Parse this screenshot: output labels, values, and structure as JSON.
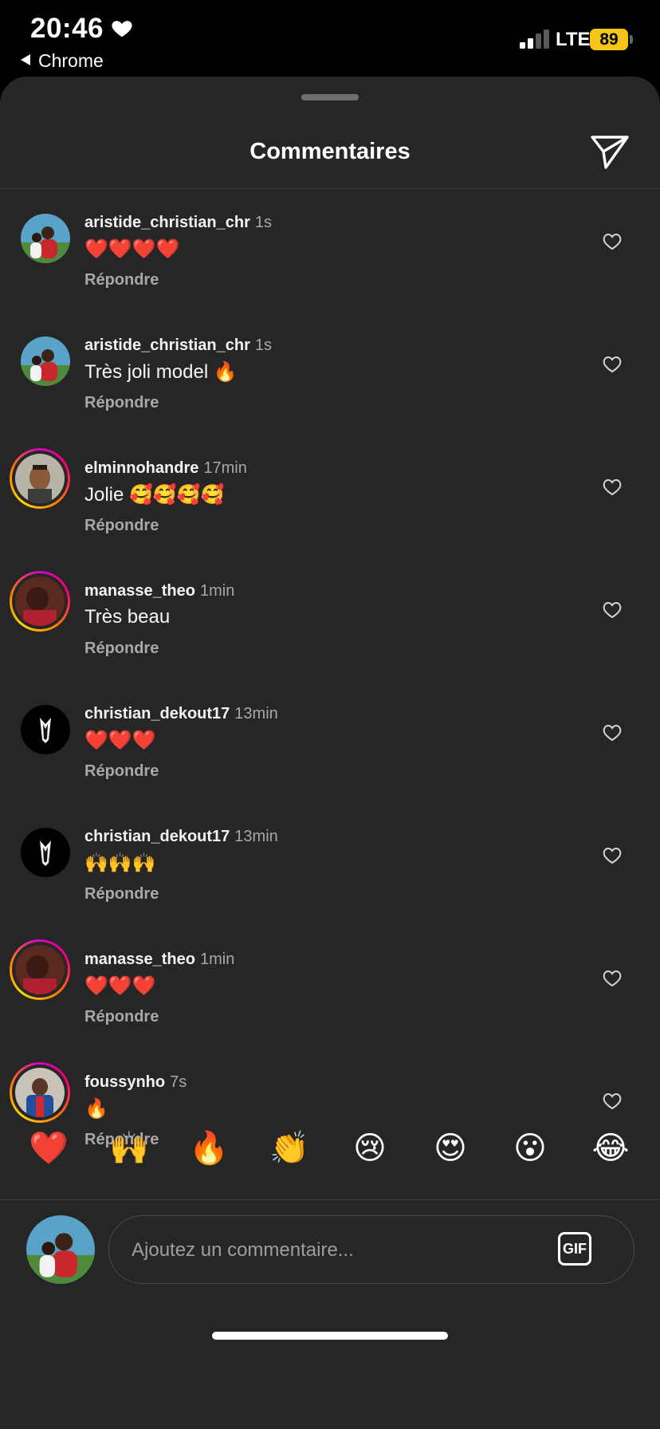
{
  "status_bar": {
    "time": "20:46",
    "back_app": "Chrome",
    "network": "LTE",
    "battery": "89",
    "battery_color": "#f5c518"
  },
  "sheet": {
    "title": "Commentaires",
    "share_icon": "paper-plane-icon"
  },
  "comments": [
    {
      "username": "aristide_christian_chr",
      "time": "1s",
      "text": "❤️❤️❤️❤️",
      "reply": "Répondre",
      "story_ring": false
    },
    {
      "username": "aristide_christian_chr",
      "time": "1s",
      "text": "Très joli model 🔥",
      "reply": "Répondre",
      "story_ring": false
    },
    {
      "username": "elminnohandre",
      "time": "17min",
      "text": "Jolie 🥰🥰🥰🥰",
      "reply": "Répondre",
      "story_ring": true
    },
    {
      "username": "manasse_theo",
      "time": "1min",
      "text": "Très beau",
      "reply": "Répondre",
      "story_ring": true
    },
    {
      "username": "christian_dekout17",
      "time": "13min",
      "text": "❤️❤️❤️",
      "reply": "Répondre",
      "story_ring": false
    },
    {
      "username": "christian_dekout17",
      "time": "13min",
      "text": "🙌🙌🙌",
      "reply": "Répondre",
      "story_ring": false
    },
    {
      "username": "manasse_theo",
      "time": "1min",
      "text": "❤️❤️❤️",
      "reply": "Répondre",
      "story_ring": true
    },
    {
      "username": "foussynho",
      "time": "7s",
      "text": "🔥",
      "reply": "Répondre",
      "story_ring": true
    }
  ],
  "quick_emojis": [
    "❤️",
    "🙌",
    "🔥",
    "👏",
    "😢",
    "😍",
    "😮",
    "😂"
  ],
  "composer": {
    "placeholder": "Ajoutez un commentaire...",
    "gif_label": "GIF"
  }
}
